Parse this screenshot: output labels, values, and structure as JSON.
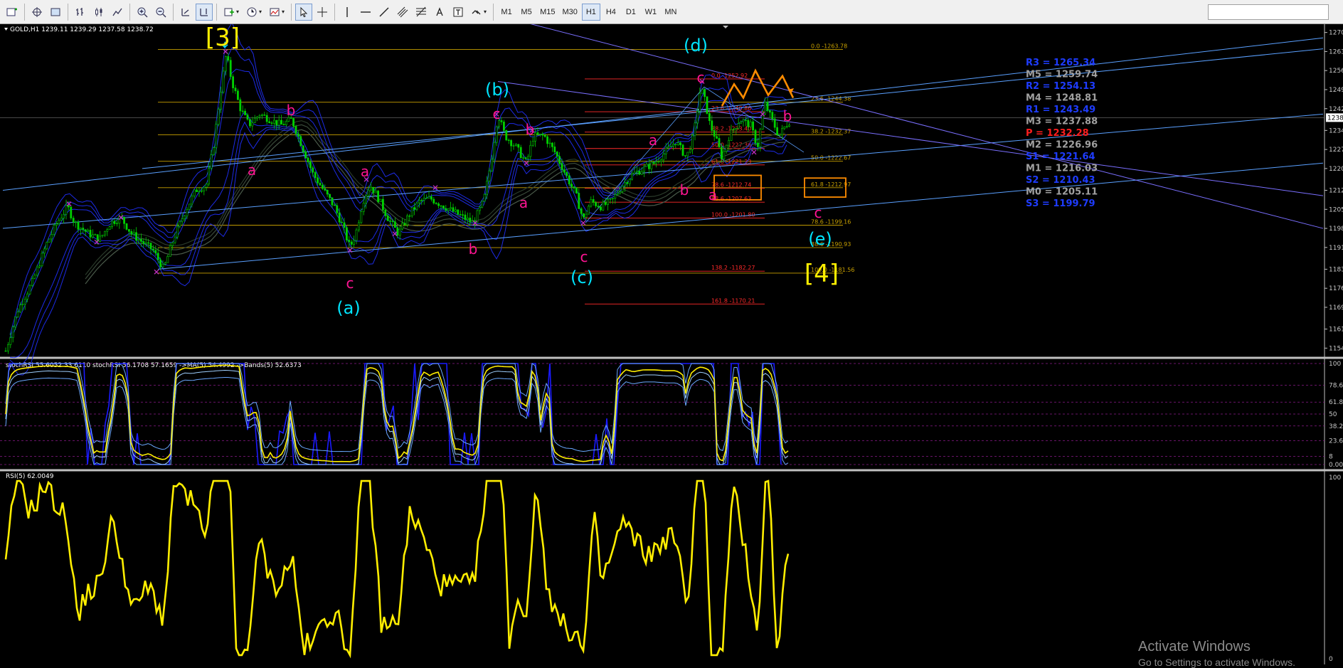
{
  "toolbar": {
    "timeframes": [
      "M1",
      "M5",
      "M15",
      "M30",
      "H1",
      "H4",
      "D1",
      "W1",
      "MN"
    ],
    "active_timeframe": "H1"
  },
  "chart": {
    "symbol_info": "GOLD,H1  1239.11 1239.29 1237.58 1238.72",
    "stoch_info": "stochRSI 55.6052 33.6110  stochRSI 56.1708 57.1659  ->MA(5) 54.4992  ->Bands(5) 52.6373",
    "rsi_info": "RSI(5) 62.0049",
    "price_axis": [
      "1270",
      "1263",
      "1256",
      "1249",
      "1242",
      "1234",
      "1227",
      "1220",
      "1212",
      "1205",
      "1198",
      "1191",
      "1183",
      "1176",
      "1169",
      "1161",
      "1154"
    ],
    "current_price": "1238",
    "stoch_axis": [
      "100",
      "78.6",
      "61.8",
      "50",
      "38.2",
      "23.6",
      "8",
      "0.00"
    ],
    "rsi_axis": [
      "100",
      "0"
    ],
    "wave_labels": {
      "w3": "[3]",
      "w4": "[4]",
      "wa": "(a)",
      "wb": "(b)",
      "wc": "(c)",
      "wd": "(d)",
      "we": "(e)",
      "a": "a",
      "b": "b",
      "c": "c"
    },
    "pivots": [
      {
        "label": "R3 = 1265.34",
        "color": "#1e3cff"
      },
      {
        "label": "M5 = 1259.74",
        "color": "#a0a0a0"
      },
      {
        "label": "R2 = 1254.13",
        "color": "#1e3cff"
      },
      {
        "label": "M4 = 1248.81",
        "color": "#a0a0a0"
      },
      {
        "label": "R1 = 1243.49",
        "color": "#1e3cff"
      },
      {
        "label": "M3 = 1237.88",
        "color": "#a0a0a0"
      },
      {
        "label": "P   = 1232.28",
        "color": "#ff1e1e"
      },
      {
        "label": "M2 = 1226.96",
        "color": "#a0a0a0"
      },
      {
        "label": "S1 = 1221.64",
        "color": "#1e3cff"
      },
      {
        "label": "M1 = 1216.03",
        "color": "#a0a0a0"
      },
      {
        "label": "S2 = 1210.43",
        "color": "#1e3cff"
      },
      {
        "label": "M0 = 1205.11",
        "color": "#a0a0a0"
      },
      {
        "label": "S3 = 1199.79",
        "color": "#1e3cff"
      }
    ],
    "fib_big": [
      {
        "label": "0.0 -1263.78"
      },
      {
        "label": "23.6 -1244.38"
      },
      {
        "label": "38.2 -1232.37"
      },
      {
        "label": "50.0 -1222.67"
      },
      {
        "label": "61.8 -1212.97"
      },
      {
        "label": "78.6 -1199.16"
      },
      {
        "label": "88.6 -1190.93"
      },
      {
        "label": "100.0 -1181.56"
      }
    ],
    "fib_small": [
      {
        "label": "0.0 -1252.92"
      },
      {
        "label": "23.6 -1240.86"
      },
      {
        "label": "38.2 -1233.40"
      },
      {
        "label": "50.0 -1227.36"
      },
      {
        "label": "61.8 -1221.33"
      },
      {
        "label": "78.6 -1212.74"
      },
      {
        "label": "88.6 -1207.63"
      },
      {
        "label": "100.0 -1201.80"
      },
      {
        "label": "138.2 -1182.27"
      },
      {
        "label": "161.8 -1170.21"
      }
    ],
    "colors": {
      "candle": "#00d000",
      "fib_big": "#c8a000",
      "fib_small": "#ff2a2a",
      "trend": "#5aa0ff",
      "band": "#2030ff",
      "label_pink": "#ff1493",
      "label_cyan": "#00e5ff",
      "label_yellow": "#ffee00",
      "highlight": "#ff8c00"
    }
  },
  "watermark": {
    "line1": "Activate Windows",
    "line2": "Go to Settings to activate Windows."
  }
}
